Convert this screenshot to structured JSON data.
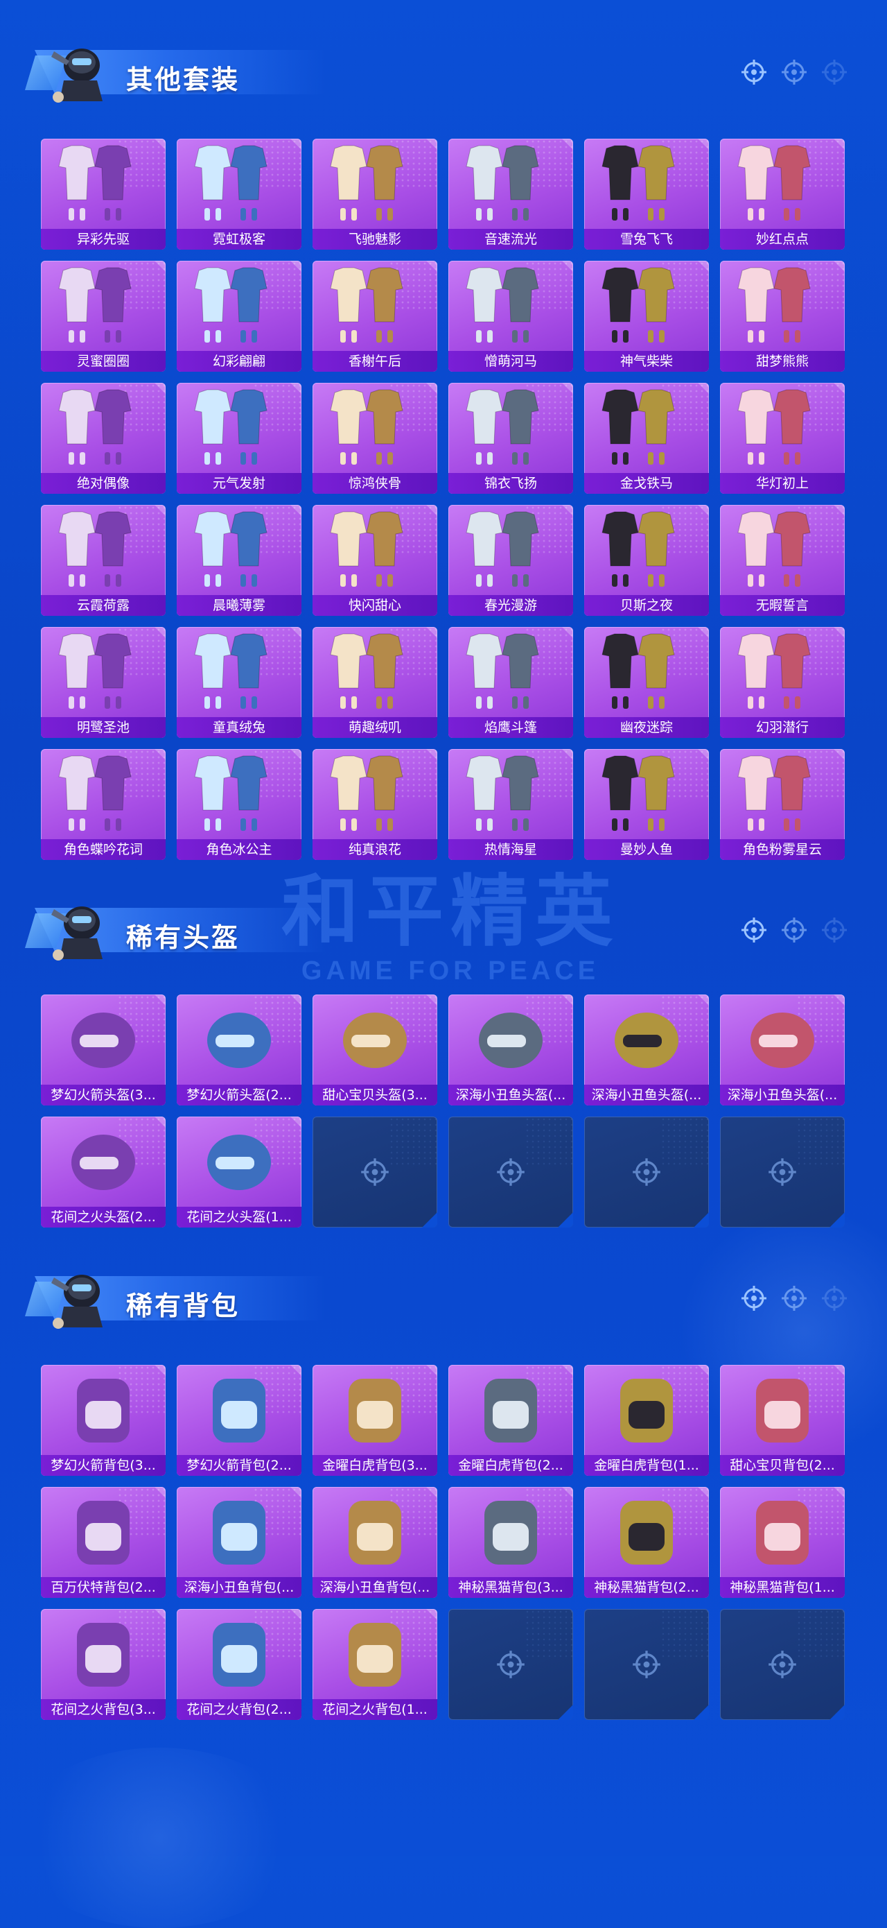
{
  "sections": [
    {
      "title": "其他套装",
      "items": [
        "异彩先驱",
        "霓虹极客",
        "飞驰魅影",
        "音速流光",
        "雪兔飞飞",
        "妙红点点",
        "灵蜜圈圈",
        "幻彩翩翩",
        "香榭午后",
        "憎萌河马",
        "神气柴柴",
        "甜梦熊熊",
        "绝对偶像",
        "元气发射",
        "惊鸿侠骨",
        "锦衣飞扬",
        "金戈铁马",
        "华灯初上",
        "云霞荷露",
        "晨曦薄雾",
        "快闪甜心",
        "春光漫游",
        "贝斯之夜",
        "无暇誓言",
        "明鹭圣池",
        "童真绒兔",
        "萌趣绒叽",
        "焰鹰斗篷",
        "幽夜迷踪",
        "幻羽潜行",
        "角色蝶吟花词",
        "角色冰公主",
        "纯真浪花",
        "热情海星",
        "曼妙人鱼",
        "角色粉雾星云"
      ],
      "empty_slots": 0
    },
    {
      "title": "稀有头盔",
      "items": [
        "梦幻火箭头盔(3...",
        "梦幻火箭头盔(2...",
        "甜心宝贝头盔(3...",
        "深海小丑鱼头盔(...",
        "深海小丑鱼头盔(...",
        "深海小丑鱼头盔(...",
        "花间之火头盔(2...",
        "花间之火头盔(1..."
      ],
      "empty_slots": 4
    },
    {
      "title": "稀有背包",
      "items": [
        "梦幻火箭背包(3...",
        "梦幻火箭背包(2...",
        "金曜白虎背包(3...",
        "金曜白虎背包(2...",
        "金曜白虎背包(1...",
        "甜心宝贝背包(2...",
        "百万伏特背包(2...",
        "深海小丑鱼背包(...",
        "深海小丑鱼背包(...",
        "神秘黑猫背包(3...",
        "神秘黑猫背包(2...",
        "神秘黑猫背包(1...",
        "花间之火背包(3...",
        "花间之火背包(2...",
        "花间之火背包(1..."
      ],
      "empty_slots": 3
    }
  ],
  "watermark": {
    "cn": "和平精英",
    "en": "GAME FOR PEACE"
  },
  "colors": {
    "background": "#0b4ed6",
    "card": "#a94fe6",
    "card_label": "#7a1fd6",
    "empty_slot": "#1d3f86"
  }
}
